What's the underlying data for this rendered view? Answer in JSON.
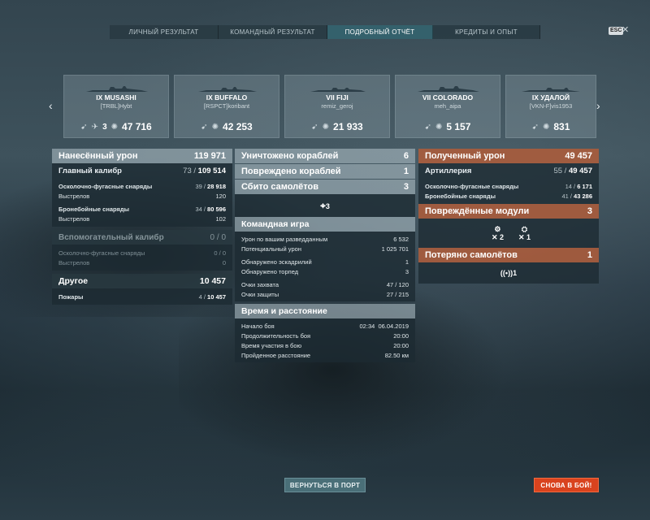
{
  "tabs": [
    {
      "label": "ЛИЧНЫЙ РЕЗУЛЬТАТ"
    },
    {
      "label": "КОМАНДНЫЙ РЕЗУЛЬТАТ"
    },
    {
      "label": "ПОДРОБНЫЙ ОТЧЁТ",
      "active": true
    },
    {
      "label": "КРЕДИТЫ И ОПЫТ"
    }
  ],
  "esc": {
    "key": "ESC",
    "close": "✕"
  },
  "nav": {
    "prev": "‹",
    "next": "›"
  },
  "ships": [
    {
      "name": "IX MUSASHI",
      "player": "[TRBL]Hybt",
      "kills": "3",
      "damage": "47 716"
    },
    {
      "name": "IX BUFFALO",
      "player": "[RSPCT]koribant",
      "damage": "42 253"
    },
    {
      "name": "VII FIJI",
      "player": "remiz_geroj",
      "damage": "21 933"
    },
    {
      "name": "VII COLORADO",
      "player": "meh_aipa",
      "damage": "5 157"
    },
    {
      "name": "IX УДАЛОЙ",
      "player": "[VKN-F]vis1953",
      "damage": "831"
    }
  ],
  "left": {
    "header": {
      "label": "Нанесённый урон",
      "value": "119 971"
    },
    "main_caliber": {
      "label": "Главный калибр",
      "a": "73",
      "b": "109 514"
    },
    "he": {
      "label": "Осколочно-фугасные снаряды",
      "a": "39",
      "b": "28 918"
    },
    "he_shots": {
      "label": "Выстрелов",
      "value": "120"
    },
    "ap": {
      "label": "Бронебойные снаряды",
      "a": "34",
      "b": "80 596"
    },
    "ap_shots": {
      "label": "Выстрелов",
      "value": "102"
    },
    "secondary": {
      "label": "Вспомогательный калибр",
      "a": "0",
      "b": "0"
    },
    "sec_he": {
      "label": "Осколочно-фугасные снаряды",
      "a": "0",
      "b": "0"
    },
    "sec_shots": {
      "label": "Выстрелов",
      "value": "0"
    },
    "other": {
      "label": "Другое",
      "value": "10 457"
    },
    "fires": {
      "label": "Пожары",
      "a": "4",
      "b": "10 457"
    }
  },
  "middle": {
    "destroyed": {
      "label": "Уничтожено кораблей",
      "value": "6"
    },
    "damaged": {
      "label": "Повреждено кораблей",
      "value": "1"
    },
    "planes": {
      "label": "Сбито самолётов",
      "value": "3"
    },
    "planes_icon_value": "3",
    "team": {
      "title": "Командная игра",
      "rows": [
        {
          "label": "Урон по вашим разведданным",
          "value": "6 532"
        },
        {
          "label": "Потенциальный урон",
          "value": "1 025 701"
        },
        {
          "label": "Обнаружено эскадрилий",
          "value": "1"
        },
        {
          "label": "Обнаружено торпед",
          "value": "3"
        },
        {
          "label": "Очки захвата",
          "a": "47",
          "b": "120"
        },
        {
          "label": "Очки защиты",
          "a": "27",
          "b": "215"
        }
      ]
    },
    "time": {
      "title": "Время и расстояние",
      "rows": [
        {
          "label": "Начало боя",
          "value": "02:34  06.04.2019"
        },
        {
          "label": "Продолжительность боя",
          "value": "20:00"
        },
        {
          "label": "Время участия в бою",
          "value": "20:00"
        },
        {
          "label": "Пройденное расстояние",
          "value": "82.50 км"
        }
      ]
    }
  },
  "right": {
    "header": {
      "label": "Полученный урон",
      "value": "49 457"
    },
    "artillery": {
      "label": "Артиллерия",
      "a": "55",
      "b": "49 457"
    },
    "he": {
      "label": "Осколочно-фугасные снаряды",
      "a": "14",
      "b": "6 171"
    },
    "ap": {
      "label": "Бронебойные снаряды",
      "a": "41",
      "b": "43 286"
    },
    "modules": {
      "label": "Повреждённые модули",
      "value": "3"
    },
    "module_counts": [
      "2",
      "1"
    ],
    "planes_lost": {
      "label": "Потеряно самолётов",
      "value": "1"
    },
    "planes_lost_icon_value": "1"
  },
  "buttons": {
    "port": "ВЕРНУТЬСЯ В ПОРТ",
    "battle": "СНОВА В БОЙ!"
  }
}
